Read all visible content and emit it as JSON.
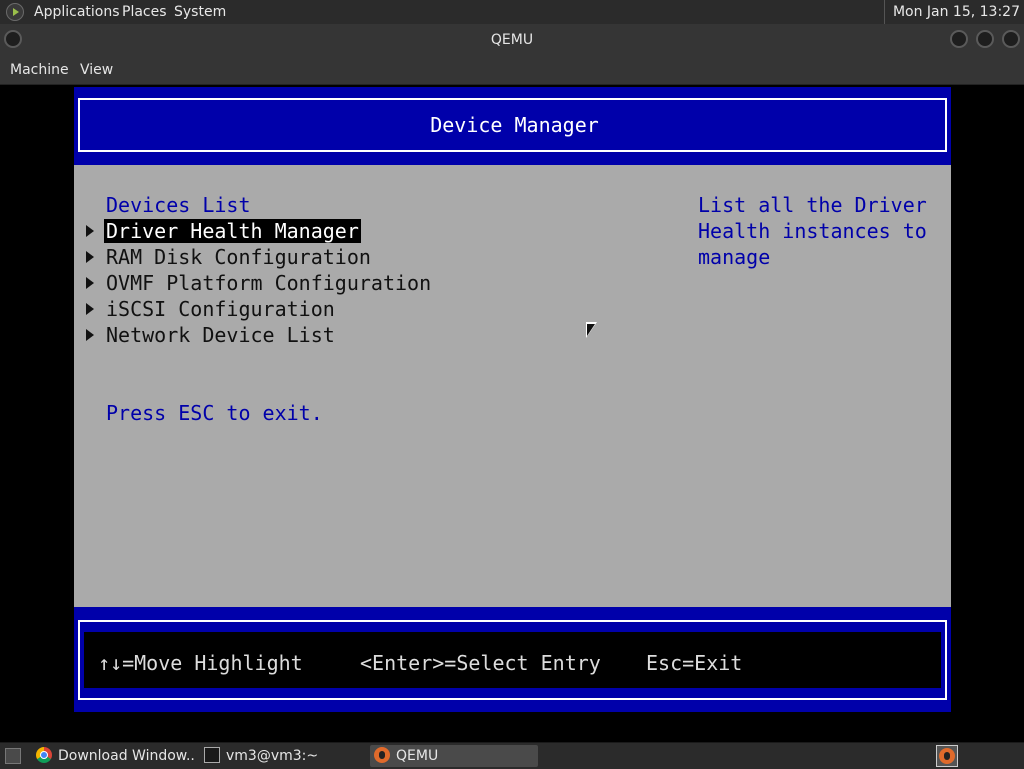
{
  "top_panel": {
    "menus": [
      "Applications",
      "Places",
      "System"
    ],
    "clock": "Mon Jan 15, 13:27"
  },
  "window": {
    "title": "QEMU",
    "menu": [
      "Machine",
      "View"
    ]
  },
  "firmware": {
    "header_title": "Device Manager",
    "section_title": "Devices List",
    "entries": [
      "Driver Health Manager",
      "RAM Disk Configuration",
      "OVMF Platform Configuration",
      "iSCSI Configuration",
      "Network Device List"
    ],
    "selected_entry": "Driver Health Manager",
    "esc_hint": "Press ESC to exit.",
    "help_text": "List all the Driver Health instances to manage",
    "footer": {
      "move": "↑↓=Move Highlight",
      "enter": "<Enter>=Select Entry",
      "exit": "Esc=Exit"
    },
    "colors": {
      "background": "#aaaaaa",
      "accent_blue": "#0000aa",
      "highlight": "#000000"
    }
  },
  "taskbar": {
    "tasks": [
      {
        "label": "Download Window...",
        "icon": "chrome-icon"
      },
      {
        "label": "vm3@vm3:~",
        "icon": "terminal-icon"
      },
      {
        "label": "QEMU",
        "icon": "qemu-icon",
        "active": true
      }
    ]
  }
}
